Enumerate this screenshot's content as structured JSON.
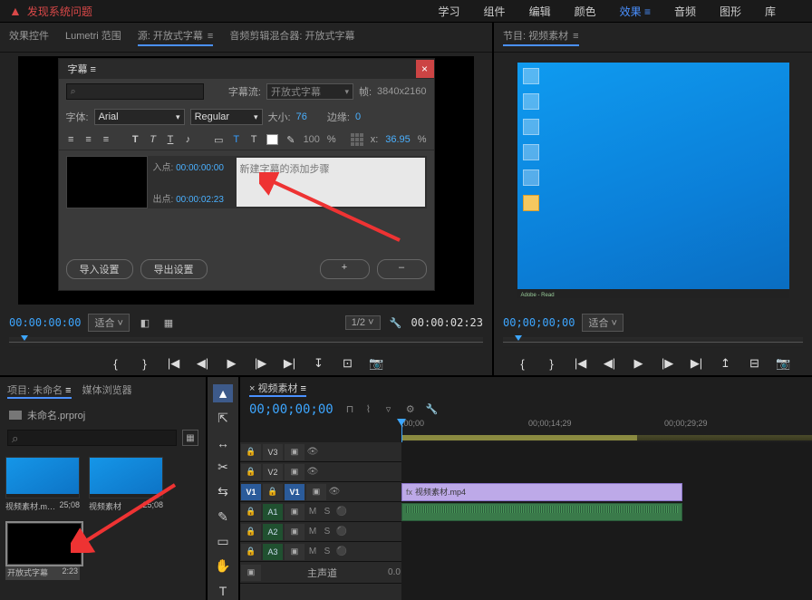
{
  "titlebar": {
    "text": "发现系统问题"
  },
  "topnav": {
    "items": [
      "学习",
      "组件",
      "编辑",
      "颜色",
      "效果",
      "音频",
      "图形",
      "库"
    ],
    "active_index": 4
  },
  "source_panel": {
    "tabs": [
      "效果控件",
      "Lumetri 范围",
      "源: 开放式字幕",
      "音频剪辑混合器: 开放式字幕"
    ],
    "active": 2
  },
  "caption": {
    "title": "字幕",
    "search_placeholder": "⌕",
    "stream_label": "字幕流:",
    "stream_value": "开放式字幕",
    "frame_label": "帧:",
    "frame_value": "3840x2160",
    "font_label": "字体:",
    "font_value": "Arial",
    "weight_value": "Regular",
    "size_label": "大小:",
    "size_value": "76",
    "edge_label": "边缘:",
    "edge_value": "0",
    "opacity_value": "100",
    "percent": "%",
    "xpos_label": "x:",
    "xpos_value": "36.95",
    "entry": {
      "in_label": "入点:",
      "in_tc": "00:00:00:00",
      "out_label": "出点:",
      "out_tc": "00:00:02:23",
      "text_placeholder": "新建字幕的添加步骤"
    },
    "btn_import": "导入设置",
    "btn_export": "导出设置",
    "btn_plus": "+",
    "btn_minus": "–"
  },
  "src_transport": {
    "tc_left": "00:00:00:00",
    "fit": "适合",
    "scale": "1/2",
    "tc_right": "00:00:02:23"
  },
  "program_panel": {
    "tab": "节目: 视频素材",
    "taskbar_text": "Adobe - Read"
  },
  "prog_transport": {
    "tc_left": "00;00;00;00",
    "fit": "适合"
  },
  "project": {
    "tabs": [
      "项目: 未命名",
      "媒体浏览器"
    ],
    "active": 0,
    "file": "未命名.prproj",
    "bins": [
      {
        "name": "视频素材.m…",
        "dur": "25;08",
        "type": "desk"
      },
      {
        "name": "视频素材",
        "dur": "25;08",
        "type": "desk"
      },
      {
        "name": "开放式字幕",
        "dur": "2:23",
        "type": "black",
        "sel": true
      }
    ]
  },
  "tools": [
    "▲",
    "⇱",
    "✂",
    "↔",
    "✎",
    "▭",
    "✋",
    "T"
  ],
  "timeline": {
    "tab": "× 视频素材",
    "tc": "00;00;00;00",
    "ruler": [
      {
        "pos": 0,
        "lab": ";00;00"
      },
      {
        "pos": 140,
        "lab": "00;00;14;29"
      },
      {
        "pos": 290,
        "lab": "00;00;29;29"
      }
    ],
    "tracks_v": [
      "V3",
      "V2",
      "V1"
    ],
    "tracks_a": [
      "A1",
      "A2",
      "A3"
    ],
    "master": "主声道",
    "clip_name": "视频素材.mp4",
    "mix_lab": "0.0",
    "ms_m": "M",
    "ms_s": "S"
  }
}
